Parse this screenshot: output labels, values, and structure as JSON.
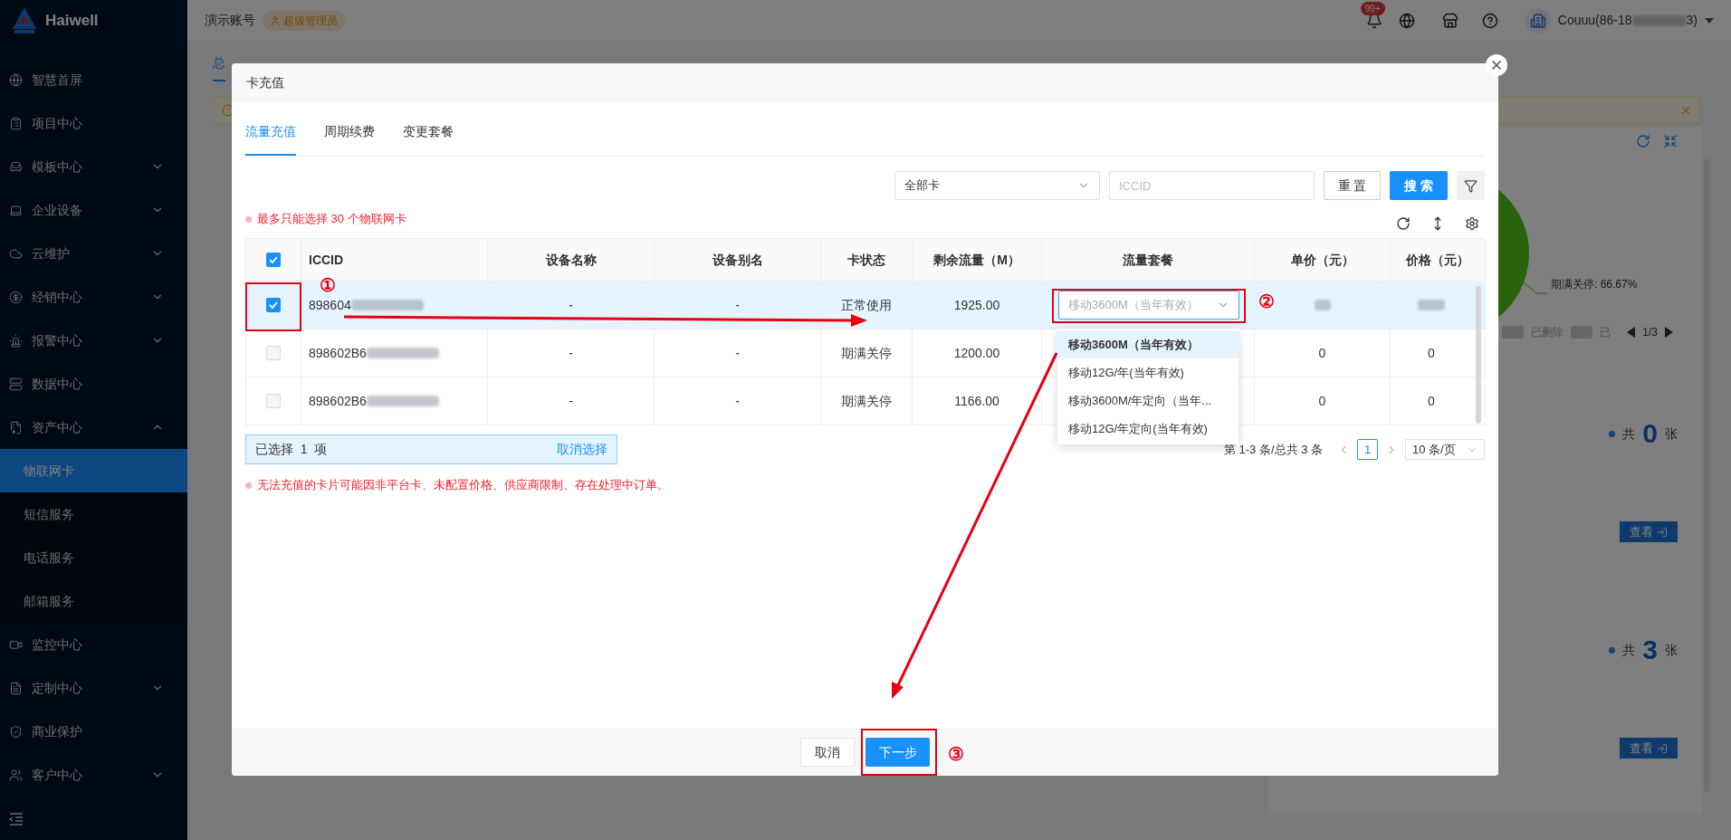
{
  "sidebar": {
    "logo": "Haiwell",
    "items": [
      {
        "label": "智慧首屏",
        "kind": "link"
      },
      {
        "label": "项目中心",
        "kind": "link"
      },
      {
        "label": "模板中心",
        "kind": "group",
        "expanded": false
      },
      {
        "label": "企业设备",
        "kind": "group",
        "expanded": false
      },
      {
        "label": "云维护",
        "kind": "group",
        "expanded": false
      },
      {
        "label": "经销中心",
        "kind": "group",
        "expanded": false
      },
      {
        "label": "报警中心",
        "kind": "group",
        "expanded": false
      },
      {
        "label": "数据中心",
        "kind": "link"
      },
      {
        "label": "资产中心",
        "kind": "group",
        "expanded": true,
        "children": [
          {
            "label": "物联网卡",
            "selected": true
          },
          {
            "label": "短信服务",
            "selected": false
          },
          {
            "label": "电话服务",
            "selected": false
          },
          {
            "label": "邮箱服务",
            "selected": false
          }
        ]
      },
      {
        "label": "监控中心",
        "kind": "link"
      },
      {
        "label": "定制中心",
        "kind": "group",
        "expanded": false
      },
      {
        "label": "商业保护",
        "kind": "link"
      },
      {
        "label": "客户中心",
        "kind": "group",
        "expanded": false
      }
    ]
  },
  "header": {
    "account": "演示账号",
    "role": "超级管理员",
    "notification_badge": "99+",
    "user": "Couuu(86-18",
    "user_suffix": "3)"
  },
  "background": {
    "tab": "总",
    "pie_label": "期满关停: 66.67%",
    "legend": [
      {
        "label": "已删除"
      },
      {
        "label": "已"
      }
    ],
    "pager": "1/3",
    "stats": [
      {
        "prefix": "共",
        "count": "0",
        "unit": "张",
        "button": "查看"
      },
      {
        "prefix": "共",
        "count": "3",
        "unit": "张",
        "button": "查看"
      }
    ]
  },
  "modal": {
    "title": "卡充值",
    "tabs": [
      {
        "label": "流量充值",
        "selected": true
      },
      {
        "label": "周期续费",
        "selected": false
      },
      {
        "label": "变更套餐",
        "selected": false
      }
    ],
    "filter": {
      "card_type": "全部卡",
      "iccid_placeholder": "ICCID",
      "reset": "重 置",
      "search": "搜 索"
    },
    "limit_note": "最多只能选择 30 个物联网卡",
    "table": {
      "all_checked": true,
      "columns": [
        "ICCID",
        "设备名称",
        "设备别名",
        "卡状态",
        "剩余流量（M）",
        "流量套餐",
        "单价（元）",
        "价格（元）"
      ],
      "rows": [
        {
          "checked": true,
          "iccid": "898604",
          "device_name": "-",
          "device_alias": "-",
          "status": "正常使用",
          "remaining": "1925.00",
          "plan": "移动3600M（当年有效）"
        },
        {
          "checked": false,
          "iccid": "898602B6",
          "device_name": "-",
          "device_alias": "-",
          "status": "期满关停",
          "remaining": "1200.00",
          "unit_price": "0",
          "price": "0"
        },
        {
          "checked": false,
          "iccid": "898602B6",
          "device_name": "-",
          "device_alias": "-",
          "status": "期满关停",
          "remaining": "1166.00",
          "unit_price": "0",
          "price": "0"
        }
      ]
    },
    "plan_options": [
      {
        "label": "移动3600M（当年有效）",
        "selected": true
      },
      {
        "label": "移动12G/年(当年有效)",
        "selected": false
      },
      {
        "label": "移动3600M/年定向（当年...",
        "selected": false
      },
      {
        "label": "移动12G/年定向(当年有效)",
        "selected": false
      }
    ],
    "selection": {
      "text": "已选择  1  项",
      "clear": "取消选择"
    },
    "pagination": {
      "summary": "第 1-3 条/总共 3 条",
      "pages": [
        {
          "label": "1",
          "selected": true
        }
      ],
      "page_size": "10 条/页"
    },
    "footnote": "无法充值的卡片可能因非平台卡、未配置价格、供应商限制、存在处理中订单。",
    "buttons": {
      "cancel": "取消",
      "next": "下一步"
    },
    "annotations": [
      "①",
      "②",
      "③"
    ]
  }
}
